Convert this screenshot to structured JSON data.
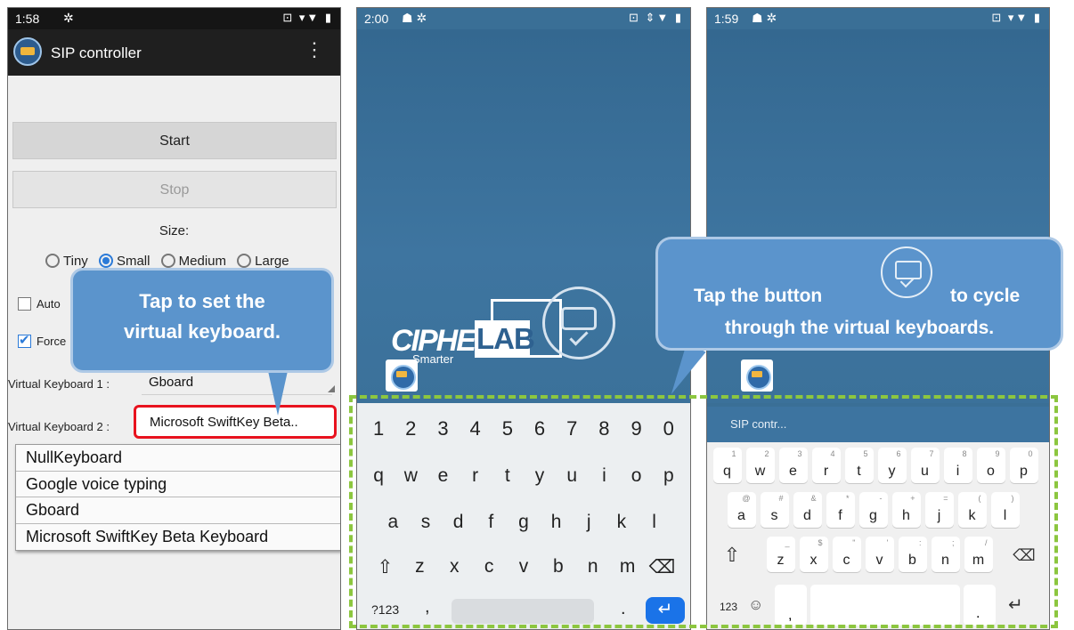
{
  "panel1": {
    "status": {
      "time": "1:58",
      "icons": "⊡ ▾▼ ▮"
    },
    "app_title": "SIP controller",
    "menu_icon": "⋮",
    "start_label": "Start",
    "stop_label": "Stop",
    "size_label": "Size:",
    "sizes": [
      "Tiny",
      "Small",
      "Medium",
      "Large"
    ],
    "selected_size": "Small",
    "auto_label": "Auto",
    "force_label": "Force",
    "vk1_label": "Virtual Keyboard 1 :",
    "vk1_value": "Gboard",
    "vk2_label": "Virtual Keyboard 2 :",
    "vk2_value": "Microsoft SwiftKey Beta..",
    "dropdown_options": [
      "NullKeyboard",
      "Google voice typing",
      "Gboard",
      "Microsoft SwiftKey Beta Keyboard"
    ],
    "callout_line1": "Tap to set the",
    "callout_line2": "virtual keyboard."
  },
  "panel2": {
    "status": {
      "time": "2:00",
      "icons": "⊡ ⇕▼ ▮"
    },
    "logo_word": "CIPHER",
    "logo_lab": "LAB",
    "logo_tagline": "Smarter",
    "gboard": {
      "numbers": [
        "1",
        "2",
        "3",
        "4",
        "5",
        "6",
        "7",
        "8",
        "9",
        "0"
      ],
      "row1": [
        "q",
        "w",
        "e",
        "r",
        "t",
        "y",
        "u",
        "i",
        "o",
        "p"
      ],
      "row2": [
        "a",
        "s",
        "d",
        "f",
        "g",
        "h",
        "j",
        "k",
        "l"
      ],
      "row3": [
        "⇧",
        "z",
        "x",
        "c",
        "v",
        "b",
        "n",
        "m",
        "⌫"
      ],
      "sym_key": "?123",
      "comma": ",",
      "period": ".",
      "enter": "↵"
    }
  },
  "panel3": {
    "status": {
      "time": "1:59",
      "icons": "⊡ ▾▼ ▮"
    },
    "sip_title": "SIP contr...",
    "swiftkey": {
      "row1": [
        [
          "q",
          "1"
        ],
        [
          "w",
          "2"
        ],
        [
          "e",
          "3"
        ],
        [
          "r",
          "4"
        ],
        [
          "t",
          "5"
        ],
        [
          "y",
          "6"
        ],
        [
          "u",
          "7"
        ],
        [
          "i",
          "8"
        ],
        [
          "o",
          "9"
        ],
        [
          "p",
          "0"
        ]
      ],
      "row2": [
        [
          "a",
          "@"
        ],
        [
          "s",
          "#"
        ],
        [
          "d",
          "&"
        ],
        [
          "f",
          "*"
        ],
        [
          "g",
          "-"
        ],
        [
          "h",
          "+"
        ],
        [
          "j",
          "="
        ],
        [
          "k",
          "("
        ],
        [
          "l",
          ")"
        ]
      ],
      "row3": [
        [
          "z",
          "_"
        ],
        [
          "x",
          "$"
        ],
        [
          "c",
          "\""
        ],
        [
          "v",
          "'"
        ],
        [
          "b",
          ":"
        ],
        [
          "n",
          ";"
        ],
        [
          "m",
          "/"
        ]
      ],
      "shift": "⇧",
      "backspace": "⌫",
      "sym_key": "123",
      "emoji": "☺",
      "comma": ",",
      "period": ".",
      "enter": "↵"
    }
  },
  "callout2": {
    "line1_a": "Tap the button",
    "line1_b": "to cycle",
    "line2": "through the virtual keyboards."
  },
  "colors": {
    "accent": "#2b7ad8",
    "callout": "#5b94cc",
    "highlight_red": "#e8121e",
    "dashed_green": "#8cc63f",
    "wallpaper": "#3a6f96"
  }
}
